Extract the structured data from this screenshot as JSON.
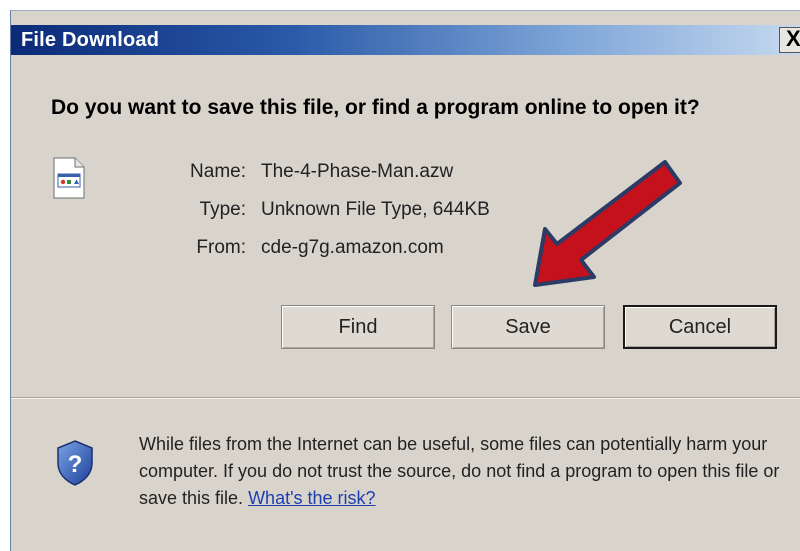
{
  "dialog": {
    "title": "File Download",
    "close_label": "X",
    "question": "Do you want to save this file, or find a program online to open it?",
    "fields": [
      {
        "label": "Name:",
        "value": "The-4-Phase-Man.azw"
      },
      {
        "label": "Type:",
        "value": "Unknown File Type, 644KB"
      },
      {
        "label": "From:",
        "value": "cde-g7g.amazon.com"
      }
    ],
    "buttons": {
      "find": "Find",
      "save": "Save",
      "cancel": "Cancel"
    },
    "warning": {
      "text": "While files from the Internet can be useful, some files can potentially harm your computer. If you do not trust the source, do not find a program to open this file or save this file.",
      "link": "What's the risk?"
    }
  },
  "annotation": {
    "arrow_color": "#c4111b",
    "arrow_outline": "#2c3b66",
    "points_to": "save-button"
  },
  "icons": {
    "file": "file-icon",
    "shield": "shield-question-icon"
  }
}
